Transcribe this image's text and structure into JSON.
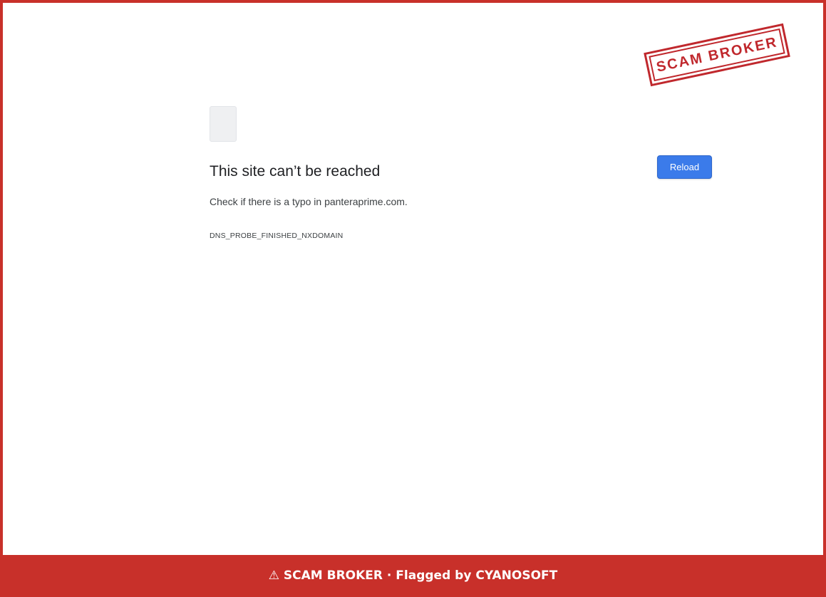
{
  "error": {
    "title": "This site can’t be reached",
    "message": "Check if there is a typo in panteraprime.com.",
    "code": "DNS_PROBE_FINISHED_NXDOMAIN",
    "reload_label": "Reload",
    "icon": "document-icon"
  },
  "stamp": {
    "text": "SCAM BROKER"
  },
  "banner": {
    "icon": "⚠",
    "text": "SCAM BROKER · Flagged by CYANOSOFT"
  },
  "colors": {
    "accent_red": "#c8302a",
    "button_blue": "#3b7bea"
  }
}
